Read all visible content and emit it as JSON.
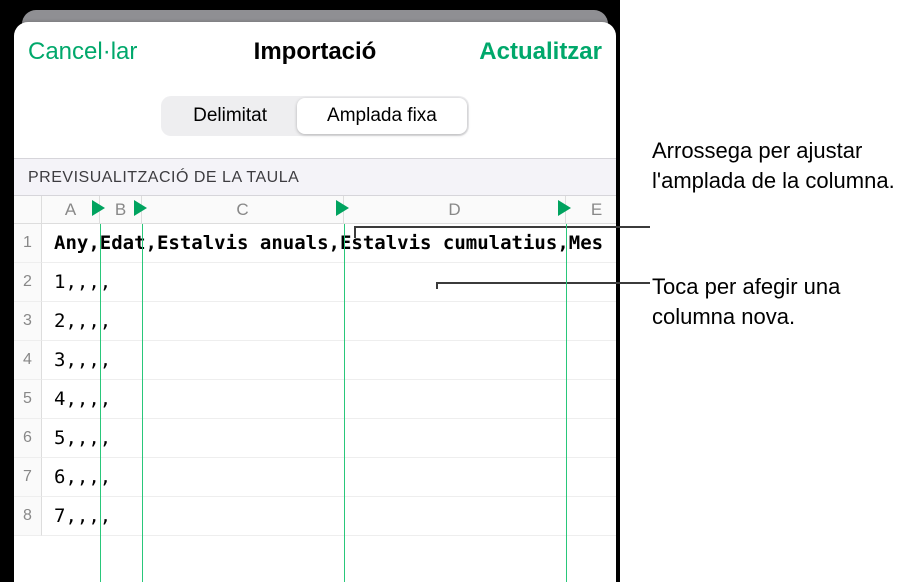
{
  "navbar": {
    "cancel": "Cancel·lar",
    "title": "Importació",
    "confirm": "Actualitzar"
  },
  "segmented": {
    "delimited": "Delimitat",
    "fixed": "Amplada fixa"
  },
  "section": {
    "preview": "PREVISUALITZACIÓ DE LA TAULA"
  },
  "columns": [
    "A",
    "B",
    "C",
    "D",
    "E"
  ],
  "rows": [
    {
      "n": "1",
      "text": "Any,Edat,Estalvis anuals,Estalvis cumulatius,Mes"
    },
    {
      "n": "2",
      "text": "1,,,,"
    },
    {
      "n": "3",
      "text": "2,,,,"
    },
    {
      "n": "4",
      "text": "3,,,,"
    },
    {
      "n": "5",
      "text": "4,,,,"
    },
    {
      "n": "6",
      "text": "5,,,,"
    },
    {
      "n": "7",
      "text": "6,,,,"
    },
    {
      "n": "8",
      "text": "7,,,,"
    }
  ],
  "callouts": {
    "drag": "Arrossega per ajustar l'amplada de la columna.",
    "tap": "Toca per afegir una columna nova."
  }
}
